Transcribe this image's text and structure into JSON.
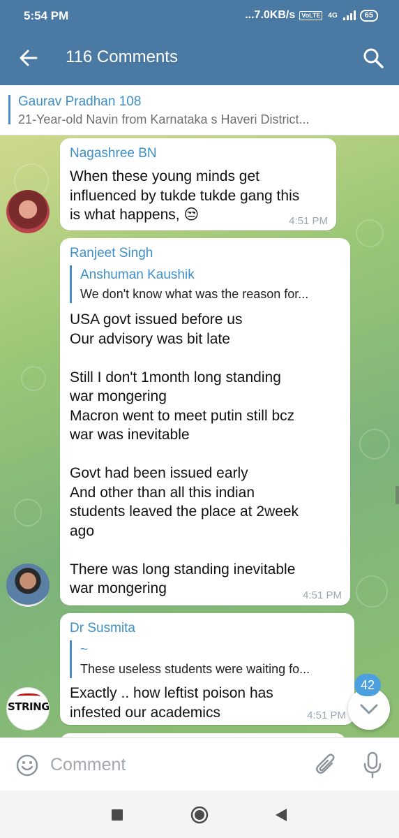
{
  "status": {
    "time": "5:54 PM",
    "network_speed": "...7.0KB/s",
    "volte": "VoLTE",
    "network_type": "4G",
    "battery": "65"
  },
  "header": {
    "title": "116 Comments",
    "back_icon": "arrow-left-icon",
    "search_icon": "search-icon"
  },
  "pinned": {
    "name": "Gaurav Pradhan 108",
    "snippet": "21-Year-old Navin from Karnataka s Haveri District..."
  },
  "messages": [
    {
      "author": "Nagashree BN",
      "text": "When these young minds get\ninfluenced by tukde tukde gang this\nis what happens, 😒",
      "time": "4:51 PM"
    },
    {
      "author": "Ranjeet Singh",
      "quote_author": "Anshuman Kaushik",
      "quote_text": "We don't know what was the reason for...",
      "text": "USA govt issued before us\nOur advisory was bit late\n\nStill I don't 1month long standing\nwar mongering\nMacron went to meet putin still bcz\nwar was inevitable\n\nGovt had been issued early\nAnd other than all this indian\nstudents leaved the place at 2week\nago\n\nThere was long standing inevitable\nwar mongering",
      "time": "4:51 PM"
    },
    {
      "author": "Dr Susmita",
      "quote_author": "~",
      "quote_text": "These useless students were waiting fo...",
      "text": "Exactly .. how leftist poison has\ninfested our academics",
      "time": "4:51 PM",
      "avatar_text": "STRING"
    }
  ],
  "scroll_badge": "42",
  "input": {
    "placeholder": "Comment"
  },
  "colors": {
    "app_bar": "#4a79a3",
    "accent": "#3d8fc9",
    "badge": "#4da0e0"
  }
}
